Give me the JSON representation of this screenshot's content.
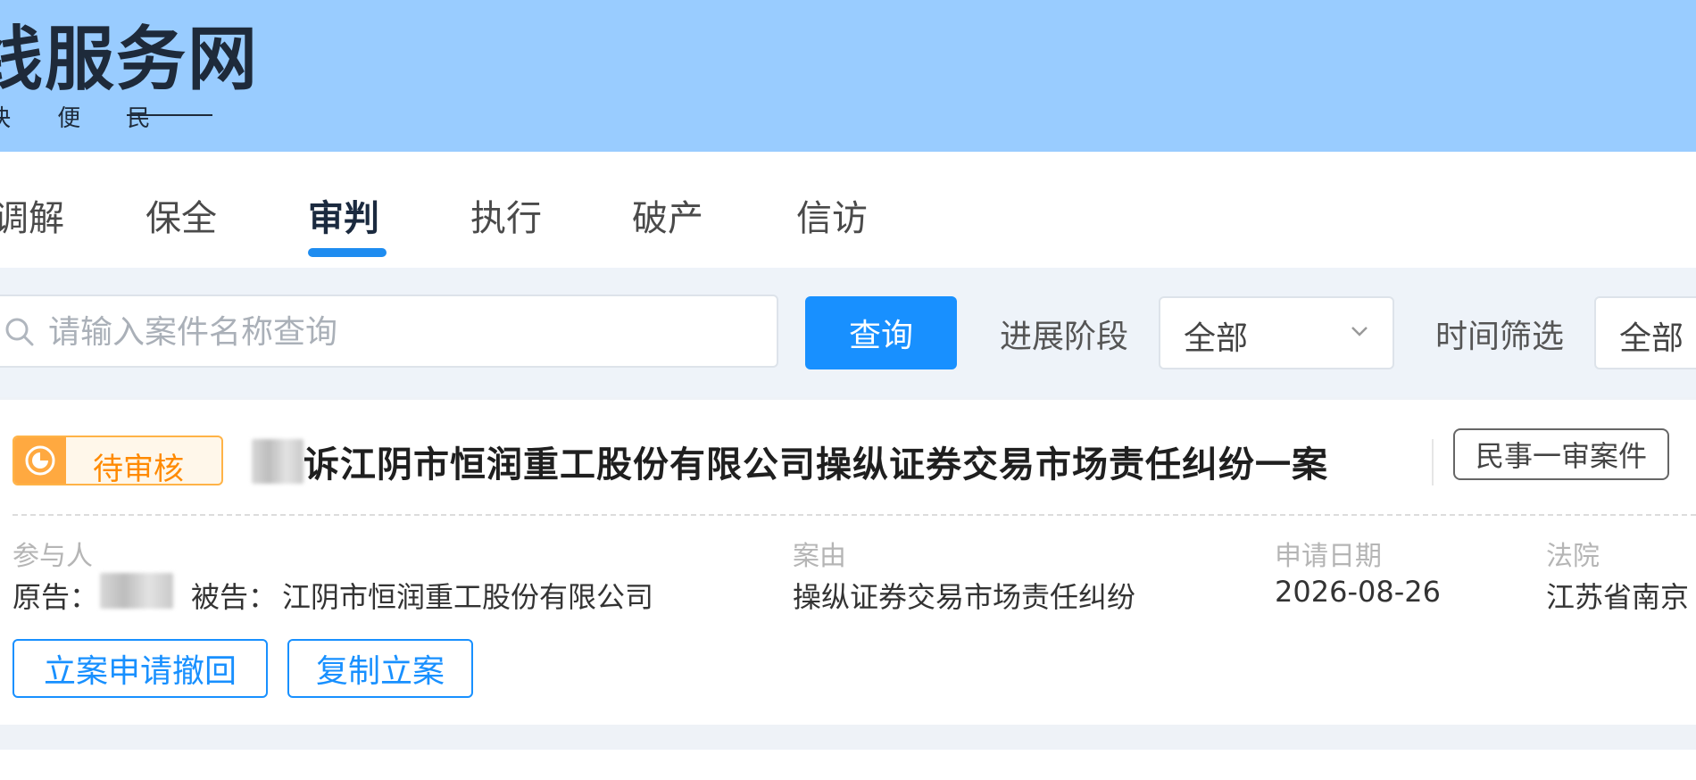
{
  "header": {
    "logo_title": "线服务网",
    "logo_subtitle": "快 便 民"
  },
  "nav": {
    "tabs": [
      {
        "label": "调解"
      },
      {
        "label": "保全"
      },
      {
        "label": "审判",
        "active": true
      },
      {
        "label": "执行"
      },
      {
        "label": "破产"
      },
      {
        "label": "信访"
      }
    ]
  },
  "filter": {
    "search_placeholder": "请输入案件名称查询",
    "search_value": "",
    "query_button": "查询",
    "stage_label": "进展阶段",
    "stage_value": "全部",
    "time_label": "时间筛选",
    "time_value": "全部"
  },
  "case": {
    "status": "待审核",
    "title_suffix": "诉江阴市恒润重工股份有限公司操纵证券交易市场责任纠纷一案",
    "type_tag": "民事一审案件",
    "participants_label": "参与人",
    "plaintiff_label": "原告：",
    "defendant_label": "被告：",
    "defendant_value": "江阴市恒润重工股份有限公司",
    "cause_label": "案由",
    "cause_value": "操纵证券交易市场责任纠纷",
    "date_label": "申请日期",
    "date_value": "2026-08-26",
    "court_label": "法院",
    "court_value": "江苏省南京",
    "withdraw_button": "立案申请撤回",
    "copy_button": "复制立案"
  },
  "colors": {
    "header_bg": "#99ccff",
    "primary": "#1890ff",
    "pending_orange": "#ffa940"
  }
}
